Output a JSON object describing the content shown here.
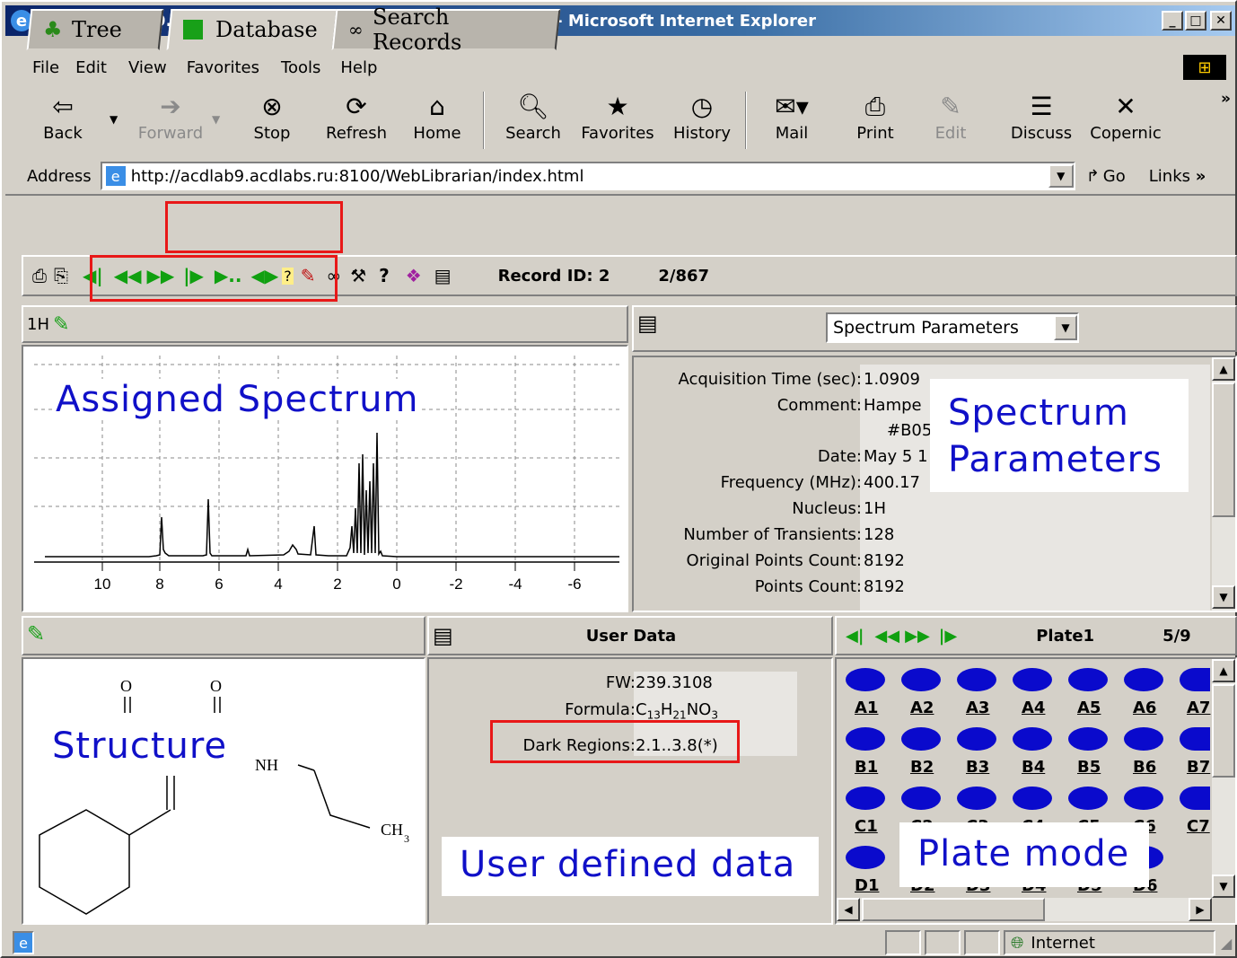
{
  "window": {
    "title": "http://acdlab9.acdlabs.ru:8100/WebLibrarian/index.html - Microsoft Internet Explorer"
  },
  "menu": [
    "File",
    "Edit",
    "View",
    "Favorites",
    "Tools",
    "Help"
  ],
  "toolbar": {
    "back": "Back",
    "forward": "Forward",
    "stop": "Stop",
    "refresh": "Refresh",
    "home": "Home",
    "search": "Search",
    "favorites": "Favorites",
    "history": "History",
    "mail": "Mail",
    "print": "Print",
    "edit": "Edit",
    "discuss": "Discuss",
    "copernic": "Copernic",
    "more": "»"
  },
  "address": {
    "label": "Address",
    "url": "http://acdlab9.acdlabs.ru:8100/WebLibrarian/index.html",
    "go": "Go",
    "links": "Links"
  },
  "app_tabs": [
    {
      "label": "Tree"
    },
    {
      "label": "Database"
    },
    {
      "label": "Search Records"
    }
  ],
  "record": {
    "id_label": "Record ID: 2",
    "position": "2/867"
  },
  "spectrum": {
    "nucleus_label": "1H",
    "overlay_label": "Assigned Spectrum",
    "x_ticks": [
      "10",
      "8",
      "6",
      "4",
      "2",
      "0",
      "-2",
      "-4",
      "-6"
    ]
  },
  "parameters": {
    "dropdown_value": "Spectrum Parameters",
    "overlay_label_1": "Spectrum",
    "overlay_label_2": "Parameters",
    "rows": [
      {
        "key": "Acquisition Time (sec):",
        "value": "1.0909"
      },
      {
        "key": "Comment:",
        "value": "Hampe"
      },
      {
        "key": "",
        "value": "#B05"
      },
      {
        "key": "Date:",
        "value": "May 5 1"
      },
      {
        "key": "Frequency (MHz):",
        "value": "400.17"
      },
      {
        "key": "Nucleus:",
        "value": "1H"
      },
      {
        "key": "Number of Transients:",
        "value": "128"
      },
      {
        "key": "Original Points Count:",
        "value": "8192"
      },
      {
        "key": "Points Count:",
        "value": "8192"
      }
    ]
  },
  "structure": {
    "overlay_label": "Structure",
    "atom_o1": "O",
    "atom_o2": "O",
    "atom_nh": "NH",
    "atom_ch": "CH",
    "atom_ch_sub": "3"
  },
  "user_data": {
    "header": "User Data",
    "overlay_label": "User defined data",
    "fw_key": "FW:",
    "fw_value": "239.3108",
    "formula_key": "Formula:",
    "formula_value": "C",
    "formula_sub1": "13",
    "formula_h": "H",
    "formula_sub2": "21",
    "formula_no": "NO",
    "formula_sub3": "3",
    "dark_key": "Dark Regions:",
    "dark_value": "2.1..3.8(*)"
  },
  "plate": {
    "name": "Plate1",
    "position": "5/9",
    "overlay_label": "Plate mode",
    "row_a": [
      "A1",
      "A2",
      "A3",
      "A4",
      "A5",
      "A6",
      "A7"
    ],
    "row_b": [
      "B1",
      "B2",
      "B3",
      "B4",
      "B5",
      "B6",
      "B7"
    ],
    "row_c": [
      "C1",
      "C2",
      "C3",
      "C4",
      "C5",
      "C6",
      "C7"
    ],
    "row_d": [
      "D1",
      "D2",
      "D3",
      "D4",
      "D5",
      "D6"
    ]
  },
  "status": {
    "zone": "Internet"
  },
  "colors": {
    "overlay_text": "#1010c8",
    "highlight": "#e81818",
    "well": "#0a0acc",
    "nav_green": "#10a010"
  }
}
